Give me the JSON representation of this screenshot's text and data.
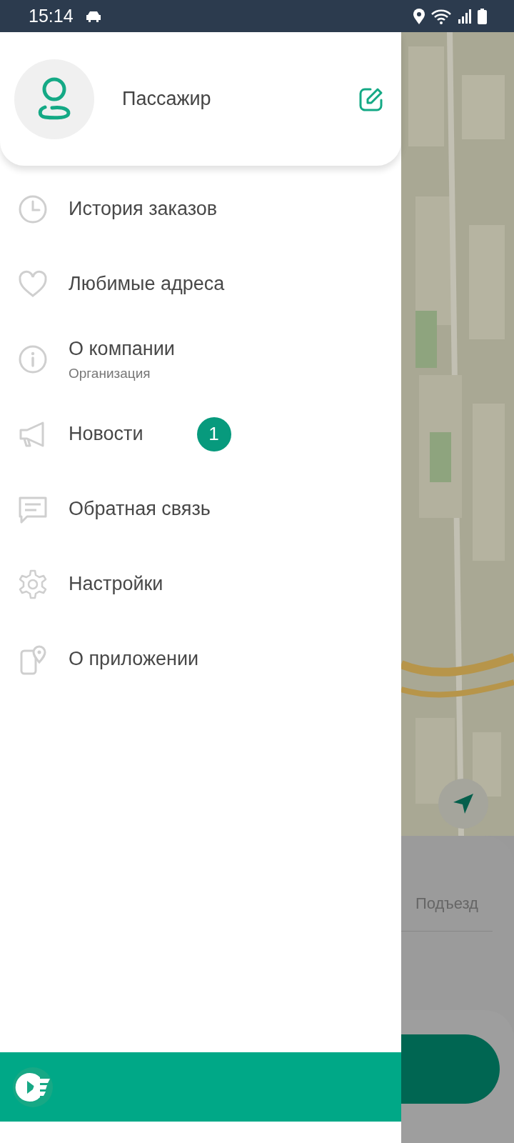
{
  "status_bar": {
    "time": "15:14"
  },
  "profile": {
    "name": "Пассажир"
  },
  "menu": [
    {
      "kind": "history",
      "label": "История заказов"
    },
    {
      "kind": "favorites",
      "label": "Любимые адреса"
    },
    {
      "kind": "company",
      "label": "О компании",
      "subtitle": "Организация"
    },
    {
      "kind": "news",
      "label": "Новости",
      "badge": "1"
    },
    {
      "kind": "feedback",
      "label": "Обратная связь"
    },
    {
      "kind": "settings",
      "label": "Настройки"
    },
    {
      "kind": "about",
      "label": "О приложении"
    }
  ],
  "background": {
    "entrance_field": {
      "placeholder": "Подъезд"
    }
  }
}
